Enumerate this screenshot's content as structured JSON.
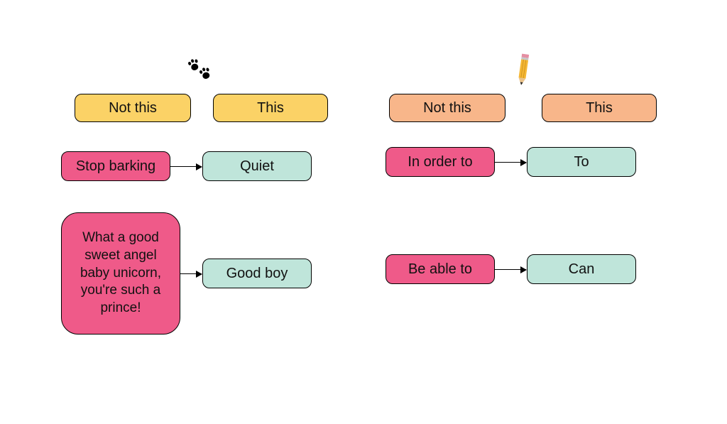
{
  "colors": {
    "header_yellow": "#fbd266",
    "header_peach": "#f8b68a",
    "bad_pink": "#ef5a89",
    "good_teal": "#bfe5da"
  },
  "left": {
    "icon": "paw-prints",
    "headers": {
      "not_this": "Not this",
      "this": "This"
    },
    "rows": [
      {
        "bad": "Stop barking",
        "good": "Quiet"
      },
      {
        "bad": "What a good sweet angel baby unicorn, you're such a prince!",
        "good": "Good boy"
      }
    ]
  },
  "right": {
    "icon": "pencil",
    "headers": {
      "not_this": "Not this",
      "this": "This"
    },
    "rows": [
      {
        "bad": "In order to",
        "good": "To"
      },
      {
        "bad": "Be able to",
        "good": "Can"
      }
    ]
  }
}
